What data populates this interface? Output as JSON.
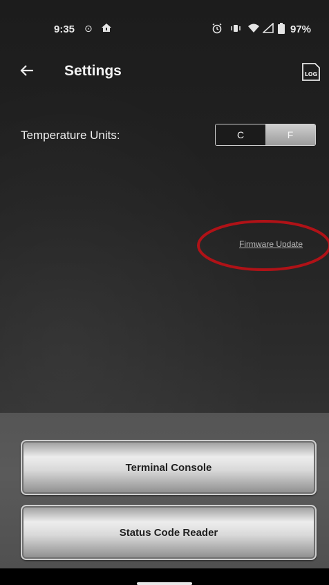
{
  "status_bar": {
    "time": "9:35",
    "icons": [
      "signal-dot-icon",
      "home-alert-icon",
      "alarm-icon",
      "vibrate-icon",
      "wifi-icon",
      "cell-signal-icon",
      "battery-icon"
    ],
    "battery": "97%"
  },
  "header": {
    "title": "Settings",
    "log_icon_text": "LOG"
  },
  "settings": {
    "temperature_label": "Temperature Units:",
    "units": {
      "options": [
        "C",
        "F"
      ],
      "selected": "F"
    },
    "firmware_link": "Firmware Update"
  },
  "buttons": {
    "terminal": "Terminal Console",
    "status_reader": "Status Code Reader"
  },
  "colors": {
    "annotation_circle": "#b01217",
    "selected_segment": "#b5b5b5",
    "bottom_panel": "#555555"
  }
}
